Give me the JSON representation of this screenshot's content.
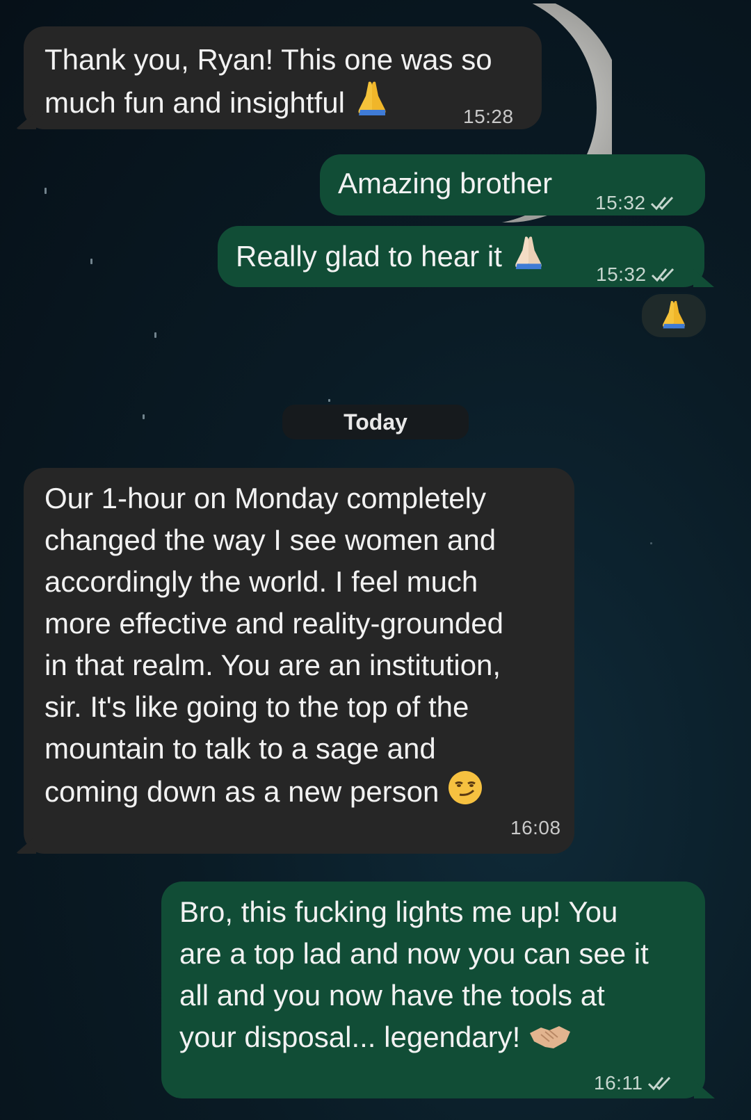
{
  "messages": [
    {
      "direction": "incoming",
      "lines": [
        "Thank you, Ryan! This one was so",
        "much fun and insightful"
      ],
      "emoji": "folded-hands-icon",
      "time": "15:28"
    },
    {
      "direction": "outgoing",
      "lines": [
        "Amazing brother"
      ],
      "time": "15:32",
      "status": "read"
    },
    {
      "direction": "outgoing",
      "lines": [
        "Really glad to hear it"
      ],
      "emoji": "folded-hands-light-icon",
      "time": "15:32",
      "status": "read",
      "reaction": "folded-hands-icon"
    },
    {
      "direction": "incoming",
      "lines": [
        "Our 1-hour on Monday completely",
        "changed the way I see women and",
        "accordingly the world. I feel much",
        "more effective and reality-grounded",
        "in that realm. You are an institution,",
        "sir. It's like going to the top of the",
        "mountain to talk to a sage and",
        "coming down as a new person"
      ],
      "emoji": "smirking-face-icon",
      "time": "16:08"
    },
    {
      "direction": "outgoing",
      "lines": [
        "Bro, this fucking lights me up! You",
        "are a top lad and now you can see it",
        "all and you now have the tools at",
        "your disposal... legendary!"
      ],
      "emoji": "handshake-icon",
      "time": "16:11",
      "status": "read"
    }
  ],
  "date_separator": "Today",
  "colors": {
    "incoming_bubble": "#262626",
    "outgoing_bubble": "#114d36",
    "background": "#0a1b25"
  }
}
